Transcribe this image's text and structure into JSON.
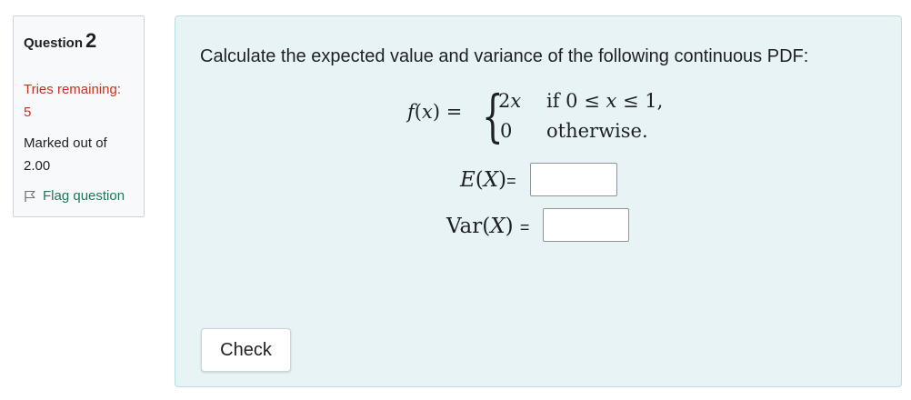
{
  "info": {
    "question_word": "Question",
    "question_number": "2",
    "tries_label": "Tries remaining:",
    "tries_value": "5",
    "marked_label": "Marked out of",
    "marked_value": "2.00",
    "flag_label": "Flag question",
    "flag_icon": "flag-outline-icon"
  },
  "question": {
    "prompt": "Calculate the expected value and variance of the following continuous PDF:",
    "pdf": {
      "lhs_name": "f",
      "lhs_open": "(",
      "lhs_var": "x",
      "lhs_close": ") =",
      "case1_expr_num": "2",
      "case1_expr_var": "x",
      "case1_cond_if": "if 0 ≤ ",
      "case1_cond_var": "x",
      "case1_cond_rest": " ≤ 1,",
      "case2_expr": "0",
      "case2_cond": "otherwise."
    },
    "ex_fn": "E",
    "ex_arg_open": "(",
    "ex_arg": "X",
    "ex_arg_close": ")",
    "ex_eq": "=",
    "ex_value": "",
    "var_fn": "Var",
    "var_arg_open": "(",
    "var_arg": "X",
    "var_arg_close": ")",
    "var_eq": "=",
    "var_value": ""
  },
  "actions": {
    "check_label": "Check"
  },
  "colors": {
    "tries": "#ca3120",
    "flag": "#1a7a5a",
    "content_bg": "#e7f3f5",
    "info_bg": "#f8f9fa"
  }
}
